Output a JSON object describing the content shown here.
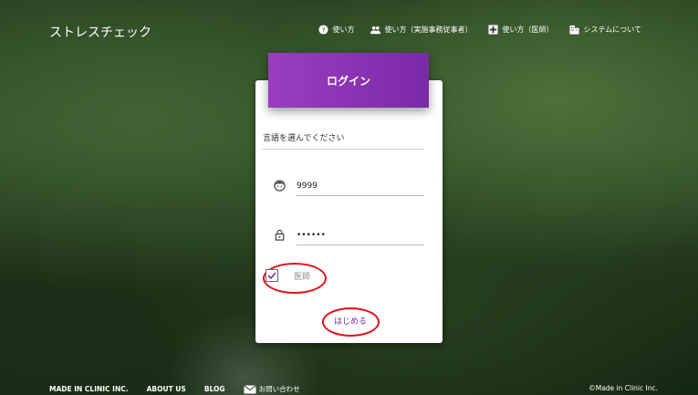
{
  "header": {
    "brand": "ストレスチェック",
    "nav": [
      {
        "label": "使い方",
        "icon": "help-circle-icon"
      },
      {
        "label": "使い方（実施事務従事者）",
        "icon": "people-icon"
      },
      {
        "label": "使い方（医師）",
        "icon": "medical-plus-icon"
      },
      {
        "label": "システムについて",
        "icon": "building-icon"
      }
    ]
  },
  "login": {
    "title": "ログイン",
    "language_placeholder": "言語を選んでください",
    "user_id": "9999",
    "password": "••••••",
    "doctor_label": "医師",
    "doctor_checked": true,
    "start_label": "はじめる"
  },
  "footer": {
    "links": [
      "MADE IN CLINIC INC.",
      "ABOUT US",
      "BLOG",
      "お問い合わせ"
    ],
    "copyright": "©Made in Clinic Inc."
  }
}
